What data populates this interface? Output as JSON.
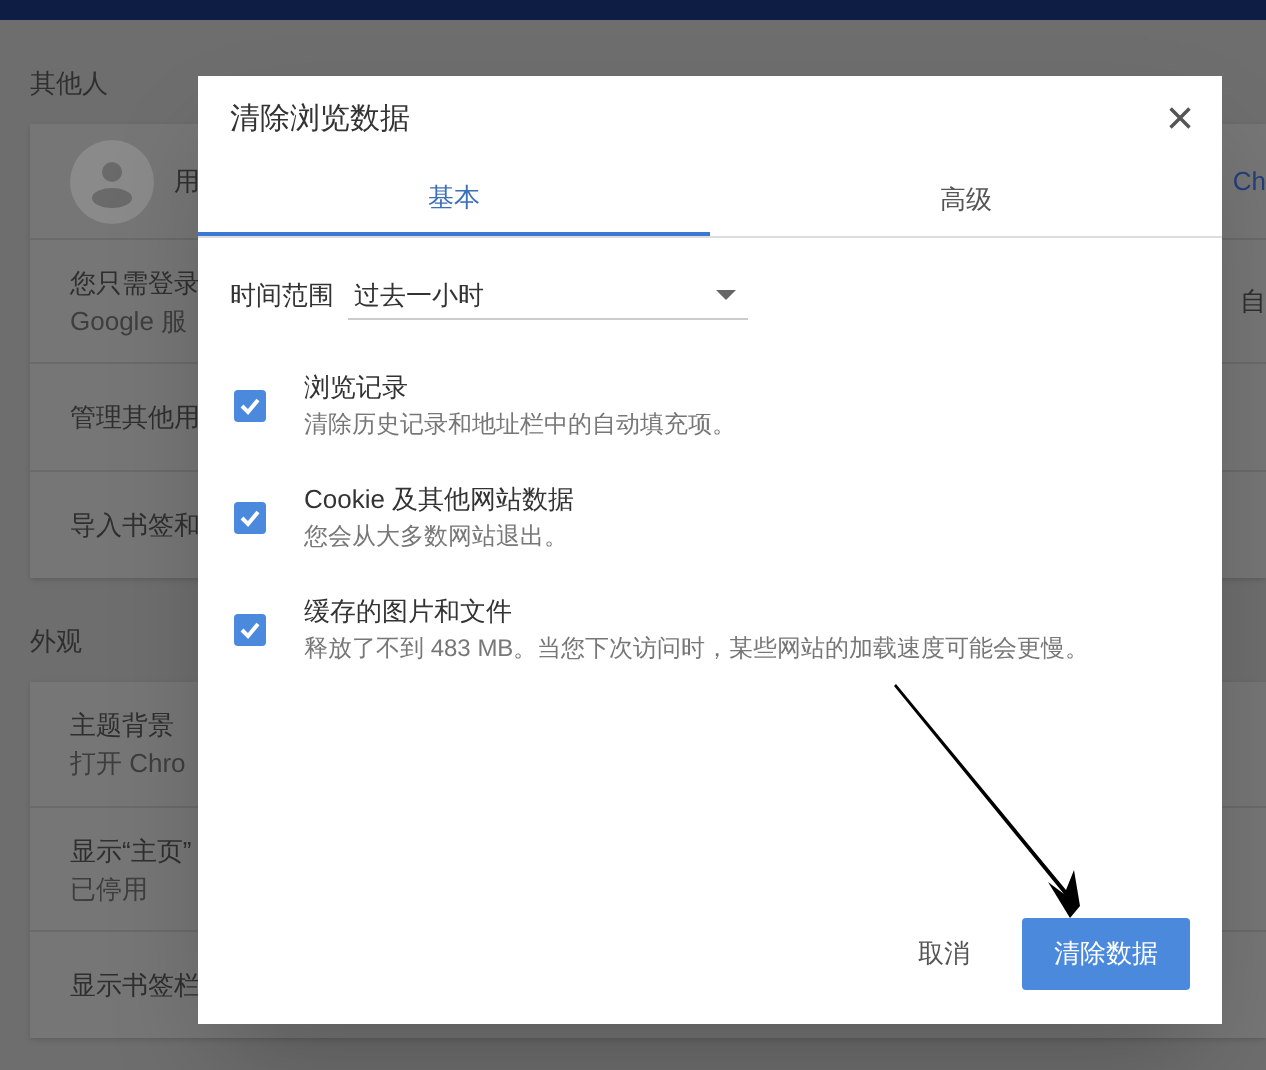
{
  "settings_page": {
    "sections": [
      {
        "title": "其他人",
        "rows": [
          {
            "kind": "profile",
            "title": "用",
            "trailing": "Ch"
          },
          {
            "kind": "text",
            "title": "您只需登录",
            "subtitle": "Google 服",
            "trailing": "自"
          },
          {
            "kind": "text",
            "title": "管理其他用"
          },
          {
            "kind": "text",
            "title": "导入书签和"
          }
        ]
      },
      {
        "title": "外观",
        "rows": [
          {
            "kind": "text",
            "title": "主题背景",
            "subtitle": "打开 Chro"
          },
          {
            "kind": "text",
            "title": "显示“主页”",
            "subtitle": "已停用"
          },
          {
            "kind": "text",
            "title": "显示书签栏"
          }
        ]
      }
    ]
  },
  "dialog": {
    "title": "清除浏览数据",
    "close": "×",
    "tabs": [
      {
        "label": "基本",
        "selected": true
      },
      {
        "label": "高级",
        "selected": false
      }
    ],
    "time_range": {
      "label": "时间范围",
      "value": "过去一小时"
    },
    "options": [
      {
        "title": "浏览记录",
        "description": "清除历史记录和地址栏中的自动填充项。",
        "checked": true
      },
      {
        "title": "Cookie 及其他网站数据",
        "description": "您会从大多数网站退出。",
        "checked": true
      },
      {
        "title": "缓存的图片和文件",
        "description": "释放了不到 483 MB。当您下次访问时，某些网站的加载速度可能会更慢。",
        "checked": true
      }
    ],
    "buttons": [
      {
        "label": "取消",
        "kind": "text"
      },
      {
        "label": "清除数据",
        "kind": "primary"
      }
    ]
  }
}
